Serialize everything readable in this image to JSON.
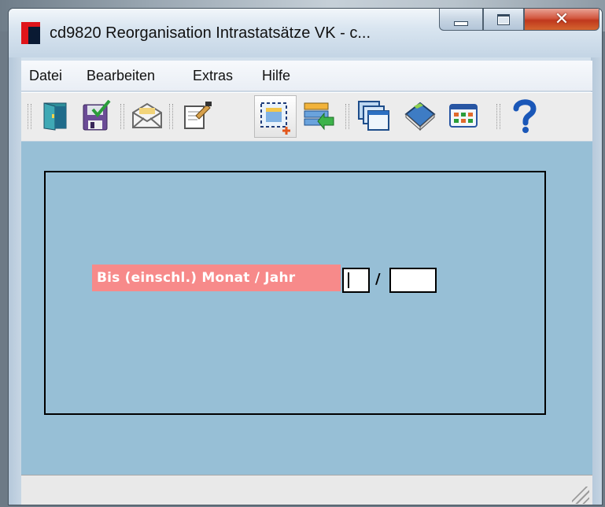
{
  "window": {
    "title": "cd9820 Reorganisation Intrastatsätze VK - c..."
  },
  "caption_buttons": {
    "minimize": "minimize",
    "maximize": "maximize",
    "close": "close"
  },
  "menu": {
    "items": [
      {
        "label": "Datei"
      },
      {
        "label": "Bearbeiten"
      },
      {
        "label": "Extras"
      },
      {
        "label": "Hilfe"
      }
    ]
  },
  "toolbar": {
    "buttons": [
      {
        "icon": "exit-door-icon"
      },
      {
        "icon": "save-check-icon"
      },
      {
        "icon": "mail-envelope-icon"
      },
      {
        "icon": "edit-document-icon"
      },
      {
        "icon": "new-record-icon",
        "active": true
      },
      {
        "icon": "list-import-icon"
      },
      {
        "icon": "windows-cascade-icon"
      },
      {
        "icon": "book-icon"
      },
      {
        "icon": "calendar-grid-icon"
      },
      {
        "icon": "help-icon"
      }
    ]
  },
  "form": {
    "label": "Bis (einschl.) Monat / Jahr",
    "separator": "/",
    "month_value": "",
    "year_value": ""
  },
  "colors": {
    "content_bg": "#97bfd6",
    "label_bg": "#f78a8a",
    "close_button": "#c0381d"
  }
}
